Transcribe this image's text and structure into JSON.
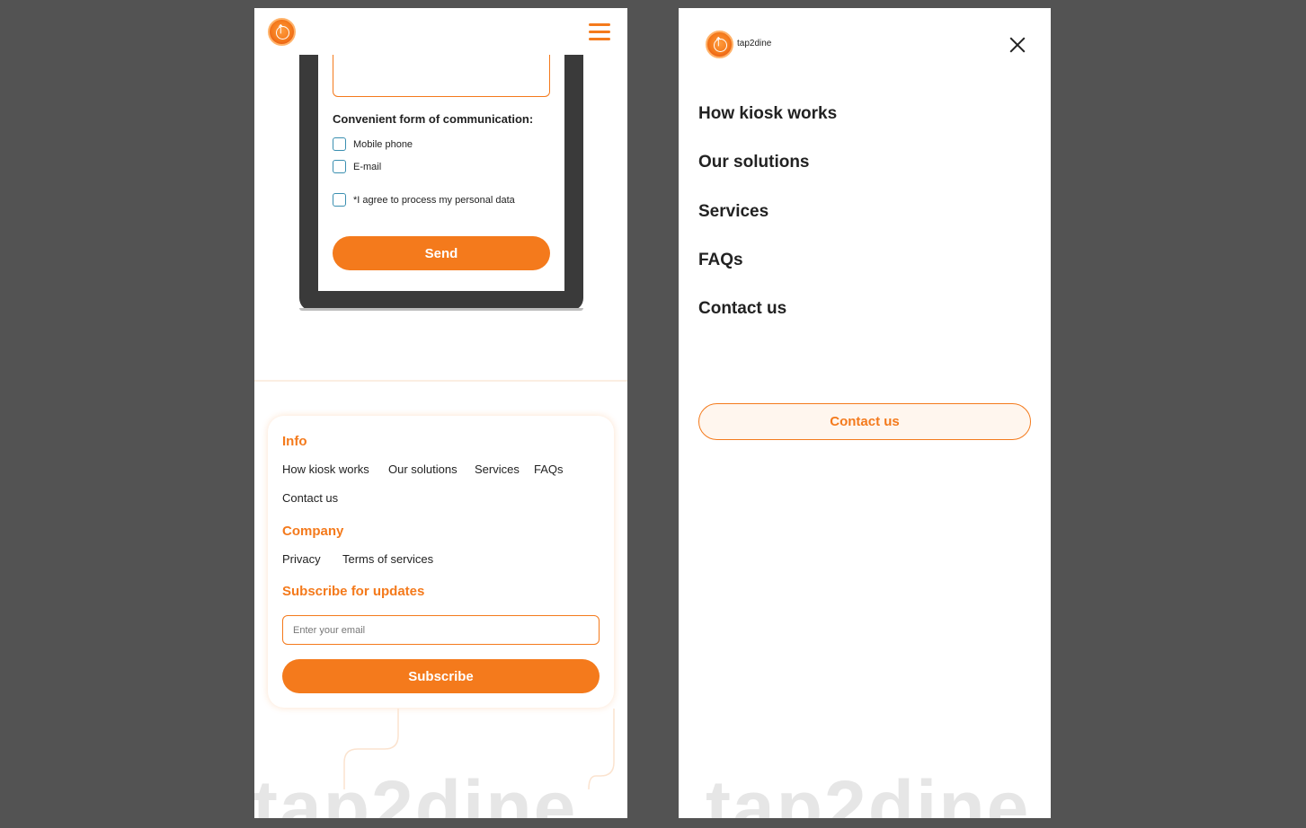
{
  "left": {
    "form": {
      "title": "Convenient form of communication:",
      "options": [
        "Mobile phone",
        "E-mail"
      ],
      "agree_label": "*I agree to process my personal data",
      "send_label": "Send"
    },
    "footer": {
      "info_heading": "Info",
      "info_links": [
        "How kiosk works",
        "Our solutions",
        "Services",
        "FAQs",
        "Contact us"
      ],
      "company_heading": "Company",
      "company_links": [
        "Privacy",
        "Terms of services"
      ],
      "subscribe_heading": "Subscribe for updates",
      "email_placeholder": "Enter your email",
      "subscribe_label": "Subscribe"
    },
    "watermark": "tap2dine"
  },
  "right": {
    "brand": "tap2dine",
    "menu": [
      "How kiosk works",
      "Our solutions",
      "Services",
      "FAQs",
      "Contact us"
    ],
    "contact_button": "Contact us",
    "watermark": "tap2dine"
  },
  "colors": {
    "accent": "#f47a1c",
    "background": "#535353",
    "checkbox": "#3a8fb0"
  },
  "icons": {
    "logo": "tap2dine-logo-icon",
    "menu": "hamburger-icon",
    "close": "close-icon"
  }
}
